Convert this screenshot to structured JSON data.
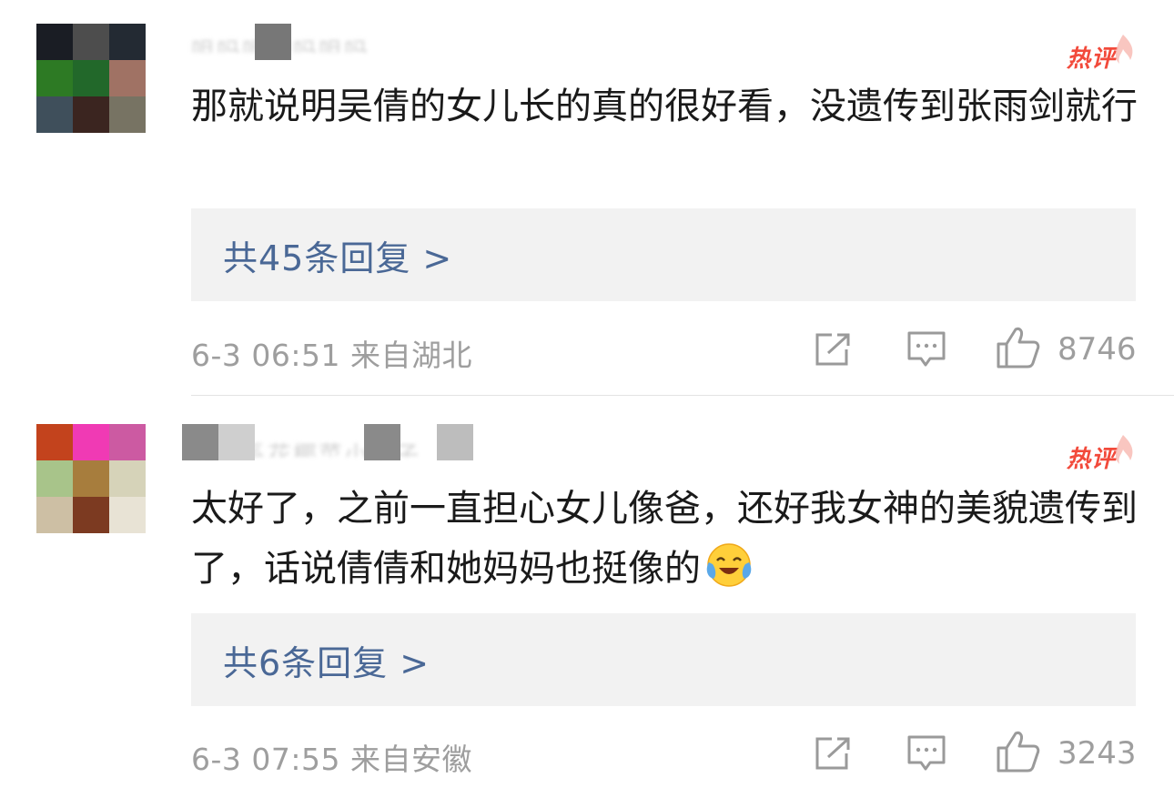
{
  "comments": [
    {
      "username": "咀吗咀嗣吗咀吗",
      "hot_label": "热评",
      "avatar_colors": [
        "#1a1d24",
        "#4d4d4d",
        "#232a33",
        "#2d7a24",
        "#22682a",
        "#a07264",
        "#3f4f5b",
        "#3b2520",
        "#777363"
      ],
      "text": "那就说明吴倩的女儿长的真的很好看，没遗传到张雨剑就行",
      "reply_label": "共45条回复 >",
      "time": "6-3 06:51",
      "location": "来自湖北",
      "likes": "8746",
      "share_icon": "share-icon",
      "comment_icon": "comment-icon",
      "like_icon": "thumbs-up-icon"
    },
    {
      "username": "银河系花椰菜小王子",
      "hot_label": "热评",
      "avatar_colors": [
        "#c3431d",
        "#f03ab4",
        "#cc5aa2",
        "#a8c48a",
        "#a77d3d",
        "#d6d3b9",
        "#cdbfa4",
        "#7c3a21",
        "#e8e3d5"
      ],
      "text": "太好了，之前一直担心女儿像爸，还好我女神的美貌遗传到了，话说倩倩和她妈妈也挺像的",
      "emoji": "laugh-cry-emoji",
      "reply_label": "共6条回复 >",
      "time": "6-3 07:55",
      "location": "来自安徽",
      "likes": "3243",
      "share_icon": "share-icon",
      "comment_icon": "comment-icon",
      "like_icon": "thumbs-up-icon"
    }
  ]
}
